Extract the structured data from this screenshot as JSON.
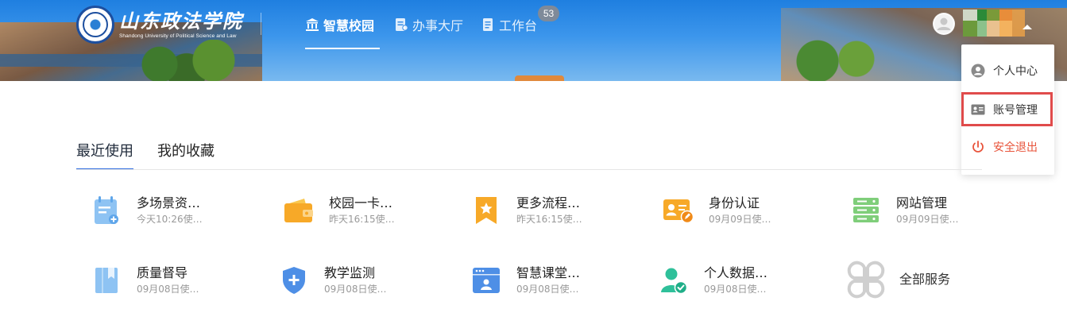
{
  "header": {
    "logo_cn": "山东政法学院",
    "logo_en": "Shandong University of Political Science and Law",
    "nav": [
      {
        "label": "智慧校园",
        "icon": "bank-icon",
        "active": true
      },
      {
        "label": "办事大厅",
        "icon": "document-icon",
        "active": false
      },
      {
        "label": "工作台",
        "icon": "notebook-icon",
        "active": false
      }
    ],
    "badge_count": "53",
    "avatar_icon": "user-avatar-icon"
  },
  "dropdown": {
    "items": [
      {
        "label": "个人中心",
        "icon": "user-circle-icon"
      },
      {
        "label": "账号管理",
        "icon": "id-card-icon"
      },
      {
        "label": "安全退出",
        "icon": "power-icon"
      }
    ],
    "highlighted_index": 1,
    "highlight_color": "#e04b4b",
    "logout_color": "#e8533a"
  },
  "tabs": [
    {
      "label": "最近使用",
      "active": true
    },
    {
      "label": "我的收藏",
      "active": false
    }
  ],
  "apps": [
    {
      "title": "多场景资…",
      "subtitle": "今天10:26使…",
      "icon": "calendar-add-icon"
    },
    {
      "title": "校园一卡…",
      "subtitle": "昨天16:15使…",
      "icon": "wallet-icon"
    },
    {
      "title": "更多流程…",
      "subtitle": "昨天16:15使…",
      "icon": "bookmark-star-icon"
    },
    {
      "title": "身份认证",
      "subtitle": "09月09日使…",
      "icon": "id-card-edit-icon"
    },
    {
      "title": "网站管理",
      "subtitle": "09月09日使…",
      "icon": "server-icon"
    },
    {
      "title": "质量督导",
      "subtitle": "09月08日使…",
      "icon": "book-bookmark-icon"
    },
    {
      "title": "教学监测",
      "subtitle": "09月08日使…",
      "icon": "shield-plus-icon"
    },
    {
      "title": "智慧课堂…",
      "subtitle": "09月08日使…",
      "icon": "browser-window-icon"
    },
    {
      "title": "个人数据…",
      "subtitle": "09月08日使…",
      "icon": "user-check-icon"
    },
    {
      "title": "全部服务",
      "subtitle": "",
      "icon": "clover-grid-icon"
    }
  ],
  "colors": {
    "accent": "#2d6cdf",
    "badge": "#7f8a99",
    "header_blue": "#1f7fe0"
  }
}
